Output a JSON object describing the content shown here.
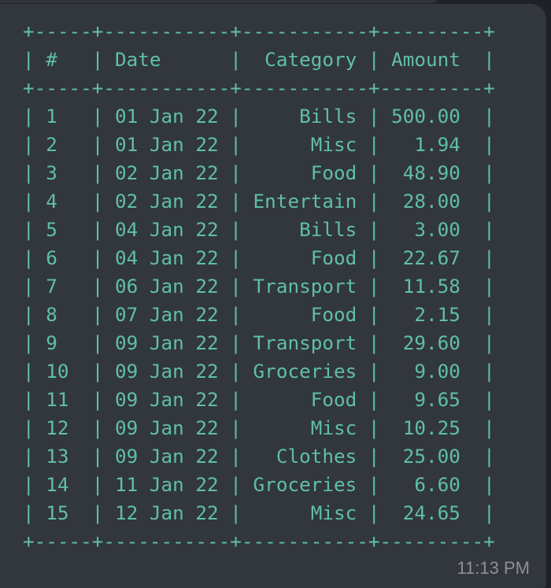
{
  "message": {
    "timestamp": "11:13 PM",
    "table": {
      "border_line": "+-----+-----------+-----------+---------+",
      "header_line": "| #   | Date      |  Category | Amount  |",
      "rows": [
        "| 1   | 01 Jan 22 |     Bills | 500.00  |",
        "| 2   | 01 Jan 22 |      Misc |   1.94  |",
        "| 3   | 02 Jan 22 |      Food |  48.90  |",
        "| 4   | 02 Jan 22 | Entertain |  28.00  |",
        "| 5   | 04 Jan 22 |     Bills |   3.00  |",
        "| 6   | 04 Jan 22 |      Food |  22.67  |",
        "| 7   | 06 Jan 22 | Transport |  11.58  |",
        "| 8   | 07 Jan 22 |      Food |   2.15  |",
        "| 9   | 09 Jan 22 | Transport |  29.60  |",
        "| 10  | 09 Jan 22 | Groceries |   9.00  |",
        "| 11  | 09 Jan 22 |      Food |   9.65  |",
        "| 12  | 09 Jan 22 |      Misc |  10.25  |",
        "| 13  | 09 Jan 22 |   Clothes |  25.00  |",
        "| 14  | 11 Jan 22 | Groceries |   6.60  |",
        "| 15  | 12 Jan 22 |      Misc |  24.65  |"
      ]
    }
  }
}
